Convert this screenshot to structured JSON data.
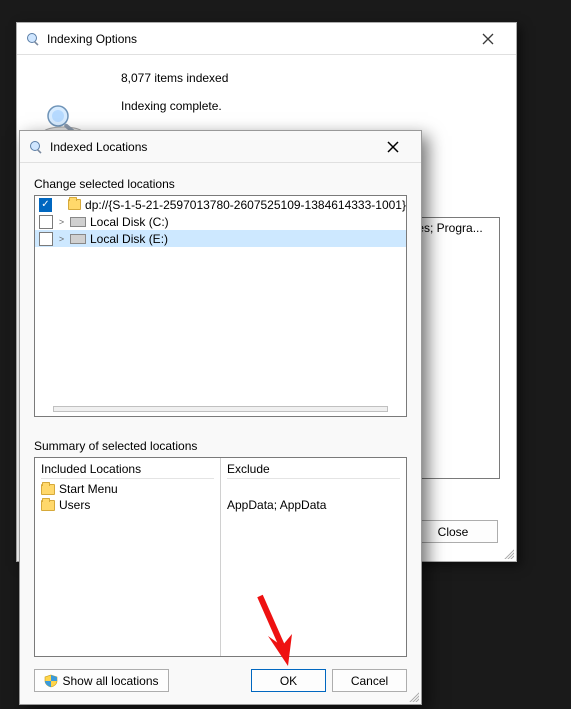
{
  "back": {
    "title": "Indexing Options",
    "items_indexed": "8,077 items indexed",
    "status": "Indexing complete.",
    "peek_text": "iles; Progra...",
    "close_label": "Close"
  },
  "front": {
    "title": "Indexed Locations",
    "change_label": "Change selected locations",
    "tree": [
      {
        "checked": true,
        "expander": "",
        "icon": "folder",
        "label": "dp://{S-1-5-21-2597013780-2607525109-1384614333-1001}"
      },
      {
        "checked": false,
        "expander": ">",
        "icon": "drive",
        "label": "Local Disk (C:)"
      },
      {
        "checked": false,
        "expander": ">",
        "icon": "drive",
        "label": "Local Disk (E:)",
        "selected": true
      }
    ],
    "summary_label": "Summary of selected locations",
    "included_header": "Included Locations",
    "exclude_header": "Exclude",
    "included": [
      "Start Menu",
      "Users"
    ],
    "exclude": [
      "",
      "AppData; AppData"
    ],
    "show_all_label": "Show all locations",
    "ok_label": "OK",
    "cancel_label": "Cancel"
  }
}
